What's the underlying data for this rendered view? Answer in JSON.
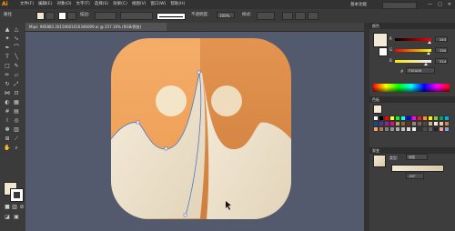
{
  "app": {
    "logo": "Ai"
  },
  "menu": [
    "文件(F)",
    "编辑(E)",
    "对象(O)",
    "文字(T)",
    "选择(S)",
    "效果(C)",
    "视图(V)",
    "窗口(W)",
    "帮助(H)"
  ],
  "workspace": "基本功能",
  "window_controls": [
    "—",
    "□",
    "✕"
  ],
  "control_bar": {
    "selection_label": "路径",
    "stroke_label": "描边:",
    "profile_value": "等比",
    "brush_value": "基本",
    "opacity_label": "不透明度:",
    "opacity_value": "100%",
    "style_label": "样式:"
  },
  "document_tab": "Mips: 985883 20150601016346009.ai @ 257.16% (RGB/预览)",
  "tools": [
    "selection-tool",
    "direct-selection-tool",
    "magic-wand-tool",
    "lasso-tool",
    "pen-tool",
    "curvature-tool",
    "type-tool",
    "line-tool",
    "rectangle-tool",
    "paintbrush-tool",
    "pencil-tool",
    "eraser-tool",
    "rotate-tool",
    "scale-tool",
    "width-tool",
    "free-transform-tool",
    "shape-builder-tool",
    "perspective-tool",
    "mesh-tool",
    "gradient-tool",
    "eyedropper-tool",
    "blend-tool",
    "symbol-sprayer-tool",
    "column-graph-tool",
    "artboard-tool",
    "slice-tool",
    "hand-tool",
    "zoom-tool"
  ],
  "color_panel": {
    "title": "颜色",
    "channels": [
      {
        "name": "R",
        "value": "243",
        "position": 0.95
      },
      {
        "name": "G",
        "value": "234",
        "position": 0.92
      },
      {
        "name": "B",
        "value": "214",
        "position": 0.84
      }
    ],
    "hex_label": "#",
    "hex_value": "F3EAD6"
  },
  "swatches_title": "色板",
  "gradient_panel": {
    "title": "渐变",
    "type_label": "类型:",
    "type_value": "线性",
    "angle_value": "-90°"
  },
  "colors": {
    "accent": "#ff9a00",
    "orange_light": "#f2a55c",
    "orange_dark": "#d9853f",
    "cream": "#f3ead6",
    "canvas_bg": "#535a6e"
  }
}
